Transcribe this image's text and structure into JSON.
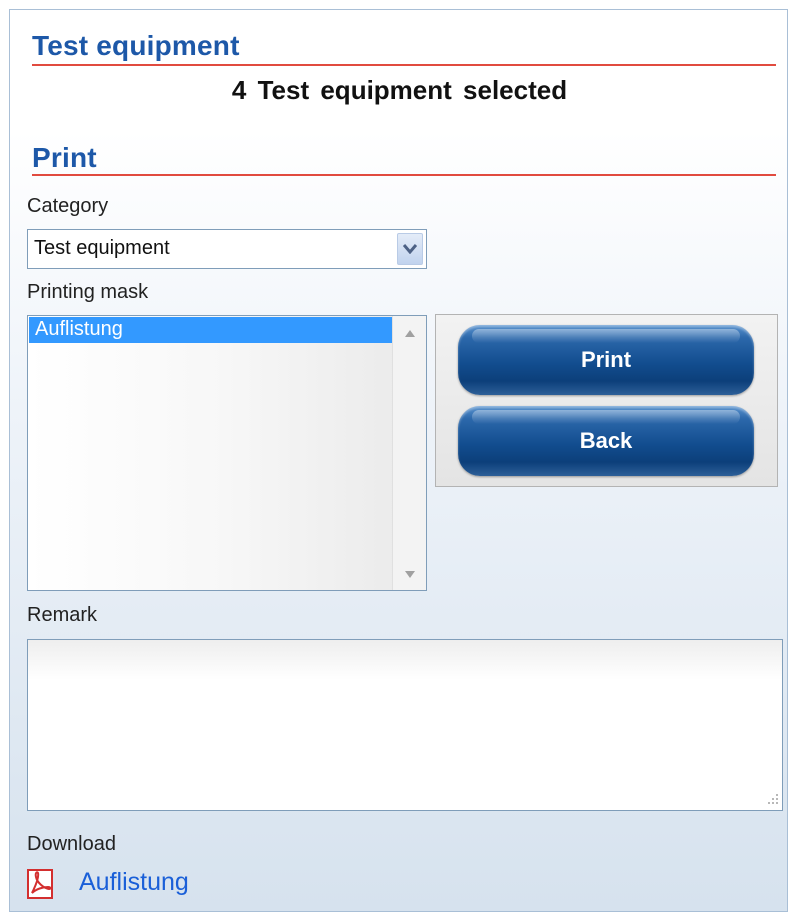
{
  "header": {
    "title": "Test equipment",
    "selection_count": "4",
    "selection_text": "Test equipment selected"
  },
  "print_section": {
    "title": "Print",
    "category": {
      "label": "Category",
      "selected_value": "Test equipment"
    },
    "printing_mask": {
      "label": "Printing mask",
      "items": [
        {
          "label": "Auflistung",
          "selected": true
        }
      ]
    },
    "buttons": {
      "print_label": "Print",
      "back_label": "Back"
    },
    "remark": {
      "label": "Remark",
      "value": ""
    },
    "download": {
      "label": "Download",
      "file_label": "Auflistung",
      "icon": "pdf-icon"
    }
  },
  "colors": {
    "title_blue": "#1d58a8",
    "rule_red": "#e14b3f",
    "selection_blue": "#3399ff",
    "button_blue": "#124d8f",
    "link_blue": "#1a5fd8"
  }
}
